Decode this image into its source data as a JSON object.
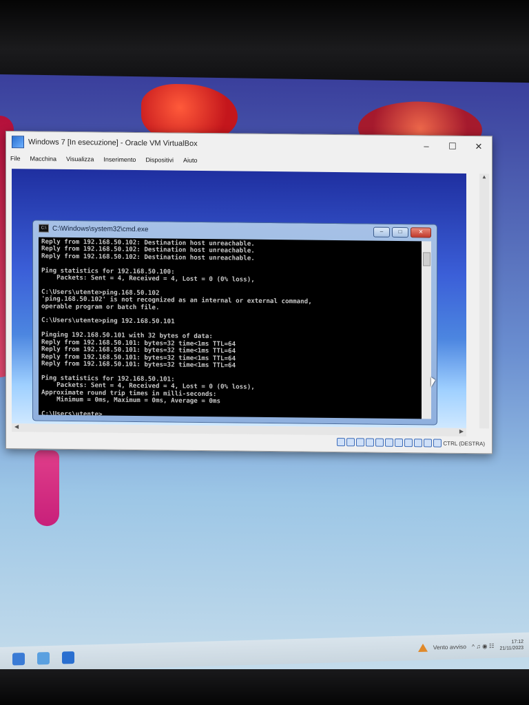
{
  "vbox": {
    "title": "Windows 7 [In esecuzione] - Oracle VM VirtualBox",
    "menu": [
      "File",
      "Macchina",
      "Visualizza",
      "Inserimento",
      "Dispositivi",
      "Aiuto"
    ],
    "host_key": "CTRL (DESTRA)"
  },
  "cmd": {
    "title": "C:\\Windows\\system32\\cmd.exe",
    "output": "Reply from 192.168.50.102: Destination host unreachable.\nReply from 192.168.50.102: Destination host unreachable.\nReply from 192.168.50.102: Destination host unreachable.\n\nPing statistics for 192.168.50.100:\n    Packets: Sent = 4, Received = 4, Lost = 0 (0% loss),\n\nC:\\Users\\utente>ping.168.50.102\n'ping.168.50.102' is not recognized as an internal or external command,\noperable program or batch file.\n\nC:\\Users\\utente>ping 192.168.50.101\n\nPinging 192.168.50.101 with 32 bytes of data:\nReply from 192.168.50.101: bytes=32 time<1ms TTL=64\nReply from 192.168.50.101: bytes=32 time<1ms TTL=64\nReply from 192.168.50.101: bytes=32 time<1ms TTL=64\nReply from 192.168.50.101: bytes=32 time<1ms TTL=64\n\nPing statistics for 192.168.50.101:\n    Packets: Sent = 4, Received = 4, Lost = 0 (0% loss),\nApproximate round trip times in milli-seconds:\n    Minimum = 0ms, Maximum = 0ms, Average = 0ms\n\nC:\\Users\\utente>"
  },
  "taskbar": {
    "weather": "Vento avviso",
    "time": "17:12",
    "date": "21/11/2023"
  },
  "colors": {
    "console_bg": "#000000",
    "console_fg": "#c8c8c8",
    "vm_desktop": "#3b5fd8"
  },
  "icons": [
    "virtualbox-icon",
    "minimize-icon",
    "maximize-icon",
    "close-icon",
    "cmd-icon",
    "warning-icon",
    "mouse-cursor-icon"
  ]
}
